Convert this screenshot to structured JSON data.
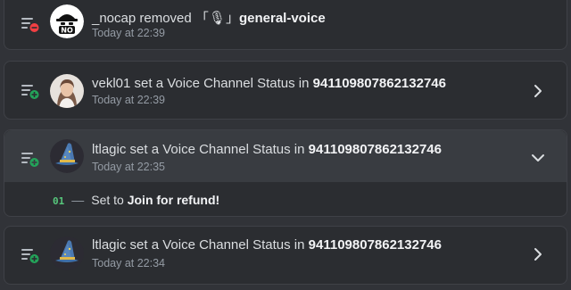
{
  "entries": [
    {
      "actor": "_nocap",
      "action": " removed ",
      "target_prefix": "「🎙」",
      "target_name": "general-voice",
      "time": "Today at 22:39",
      "action_icon": "channel-removed-icon",
      "avatar": "nocap-avatar"
    },
    {
      "actor": "vekl01",
      "action": " set a Voice Channel Status in ",
      "target_name": "941109807862132746",
      "time": "Today at 22:39",
      "action_icon": "channel-updated-icon",
      "avatar": "photo-avatar",
      "chevron": "chevron-right-icon"
    },
    {
      "actor": "ltlagic",
      "action": " set a Voice Channel Status in ",
      "target_name": "941109807862132746",
      "time": "Today at 22:35",
      "action_icon": "channel-updated-icon",
      "avatar": "wizard-hat-avatar",
      "chevron": "chevron-down-icon",
      "changes": [
        {
          "num": "01",
          "dash": "—",
          "prefix": "Set to ",
          "value": "Join for refund!"
        }
      ]
    },
    {
      "actor": "ltlagic",
      "action": " set a Voice Channel Status in ",
      "target_name": "941109807862132746",
      "time": "Today at 22:34",
      "action_icon": "channel-updated-icon",
      "avatar": "wizard-hat-avatar",
      "chevron": "chevron-right-icon"
    }
  ],
  "colors": {
    "background": "#313338",
    "card": "#2b2d31",
    "card_expanded_header": "#393c41",
    "remove_badge": "#f23f43",
    "add_badge": "#23a55a",
    "change_number": "#57c87c"
  }
}
